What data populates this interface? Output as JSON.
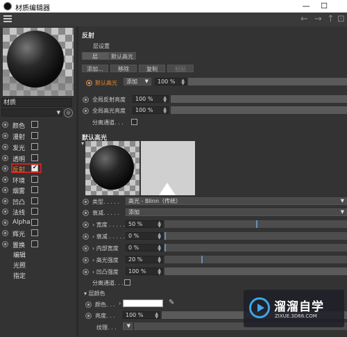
{
  "window": {
    "title": "材质编辑器",
    "minimize": "—",
    "maximize": "☐"
  },
  "toolbar": {
    "back_arrow": "←",
    "forward_arrow": "→",
    "up_arrow": "↑",
    "expand": "⊡"
  },
  "material": {
    "name": "材质"
  },
  "channels": [
    {
      "label": "颜色",
      "checked": false
    },
    {
      "label": "漫射",
      "checked": false
    },
    {
      "label": "发光",
      "checked": false
    },
    {
      "label": "透明",
      "checked": false
    },
    {
      "label": "反射",
      "checked": true
    },
    {
      "label": "环境",
      "checked": false
    },
    {
      "label": "烟雾",
      "checked": false
    },
    {
      "label": "凹凸",
      "checked": false
    },
    {
      "label": "法线",
      "checked": false
    },
    {
      "label": "Alpha",
      "checked": false
    },
    {
      "label": "辉光",
      "checked": false
    },
    {
      "label": "置换",
      "checked": false
    }
  ],
  "extra_items": [
    "编辑",
    "光照",
    "指定"
  ],
  "reflect": {
    "header": "反射",
    "layer_settings": "层设置",
    "tabs": [
      "层",
      "默认高光"
    ],
    "buttons": {
      "add": "添加...",
      "remove": "移除",
      "copy": "复制",
      "paste": "粘贴"
    },
    "layer_row": {
      "name": "默认高光",
      "mode": "添加",
      "percent": "100 %"
    },
    "global_reflect": {
      "label": "全局反射亮度",
      "value": "100 %"
    },
    "global_spec": {
      "label": "全局高光亮度",
      "value": "100 %"
    },
    "separate_pass": "分离通道. . ."
  },
  "spec_layer": {
    "header": "默认高光",
    "type": {
      "label": "类型. . . . .",
      "value": "高光 - Blinn（传统）"
    },
    "falloff": {
      "label": "衰减. . . . .",
      "value": "添加"
    },
    "params": [
      {
        "label": "宽度 . . . . .",
        "value": "50 %",
        "level": 0.5
      },
      {
        "label": "衰减 . . . . .",
        "value": "0 %",
        "level": 0.0
      },
      {
        "label": "内部宽度",
        "value": "0 %",
        "level": 0.0
      },
      {
        "label": "高光强度",
        "value": "20 %",
        "level": 0.2
      },
      {
        "label": "凹凸强度",
        "value": "100 %",
        "level": 1.0
      }
    ],
    "separate_pass": "分离通道. . ."
  },
  "layer_color": {
    "header": "层颜色",
    "color_label": "颜色. . .",
    "color_hex": "#ffffff",
    "brightness_label": "亮度. . .",
    "brightness_value": "100 %",
    "texture_label": "纹理. . ."
  },
  "watermark": {
    "name": "溜溜自学",
    "url": "ZIXUE.3D66.COM"
  }
}
